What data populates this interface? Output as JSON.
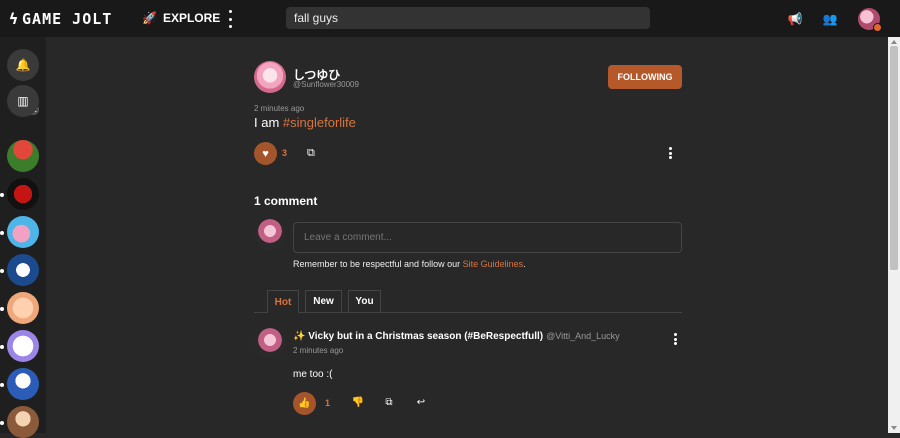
{
  "topbar": {
    "logo": "GAME JOLT",
    "explore_label": "EXPLORE",
    "search_value": "fall guys"
  },
  "sidebar": {
    "badge_count": "11"
  },
  "post": {
    "author_name": "しつゆひ",
    "author_handle": "@Sunflower30009",
    "follow_label": "FOLLOWING",
    "time": "2 minutes ago",
    "text_prefix": "I am ",
    "hashtag": "#singleforlife",
    "like_count": "3"
  },
  "comments": {
    "title": "1 comment",
    "input_placeholder": "Leave a comment...",
    "respect_text": "Remember to be respectful and follow our ",
    "guidelines_link": "Site Guidelines",
    "respect_end": ".",
    "tabs": [
      {
        "label": "Hot"
      },
      {
        "label": "New"
      },
      {
        "label": "You"
      }
    ],
    "items": [
      {
        "sparkle": "✨",
        "author": "Vicky but in a Christmas season (#BeRespectfull)",
        "handle": "@Vitti_And_Lucky",
        "time": "2 minutes ago",
        "text": "me too :(",
        "like_count": "1"
      }
    ]
  },
  "colors": {
    "accent": "#b5592b",
    "link": "#d9743f",
    "background": "#282828",
    "topbar": "#191919"
  },
  "icons": [
    "bolt-icon",
    "rocket-icon",
    "more-icon",
    "megaphone-icon",
    "friends-icon",
    "heart-icon",
    "share-icon",
    "thumb-up-icon",
    "thumb-down-icon",
    "reply-icon"
  ]
}
